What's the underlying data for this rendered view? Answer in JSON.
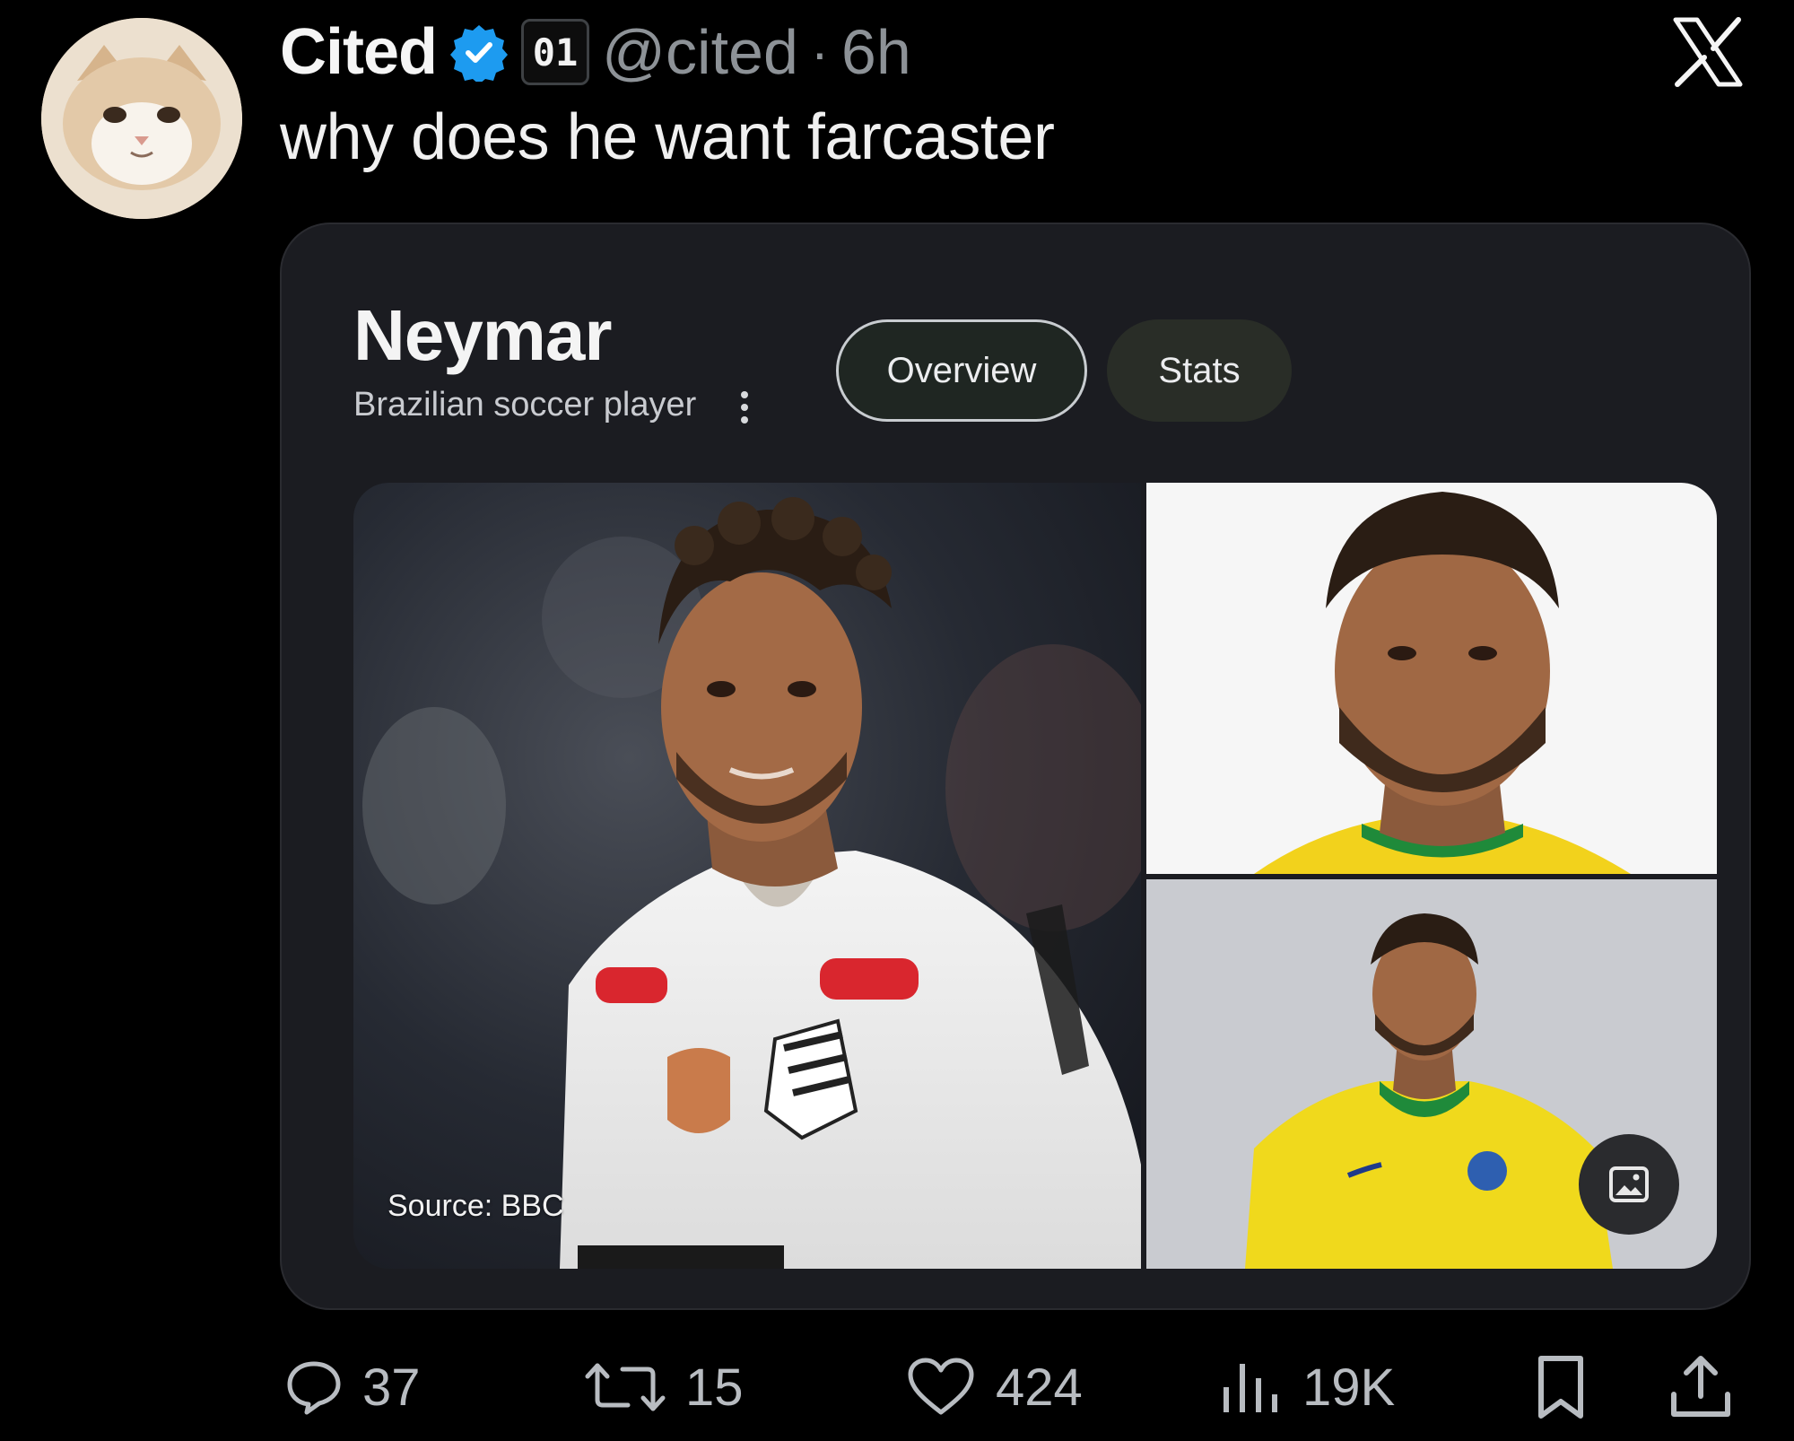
{
  "tweet": {
    "display_name": "Cited",
    "affiliate_badge": "01",
    "handle": "@cited",
    "separator": "·",
    "time": "6h",
    "text": "why does he want farcaster"
  },
  "card": {
    "title": "Neymar",
    "subtitle": "Brazilian soccer player",
    "chips": [
      "Overview",
      "Stats"
    ],
    "selected_chip": "Overview",
    "main_image_source": "Source: BBC"
  },
  "actions": {
    "replies": "37",
    "reposts": "15",
    "likes": "424",
    "views": "19K"
  },
  "colors": {
    "background": "#000000",
    "card": "#1b1c21",
    "verified": "#1d9bf0",
    "secondary_text": "#8d9297"
  },
  "icons": [
    "verified-badge-icon",
    "x-logo-icon",
    "kebab-menu-icon",
    "image-icon",
    "reply-icon",
    "repost-icon",
    "like-icon",
    "views-icon",
    "bookmark-icon",
    "share-icon"
  ]
}
